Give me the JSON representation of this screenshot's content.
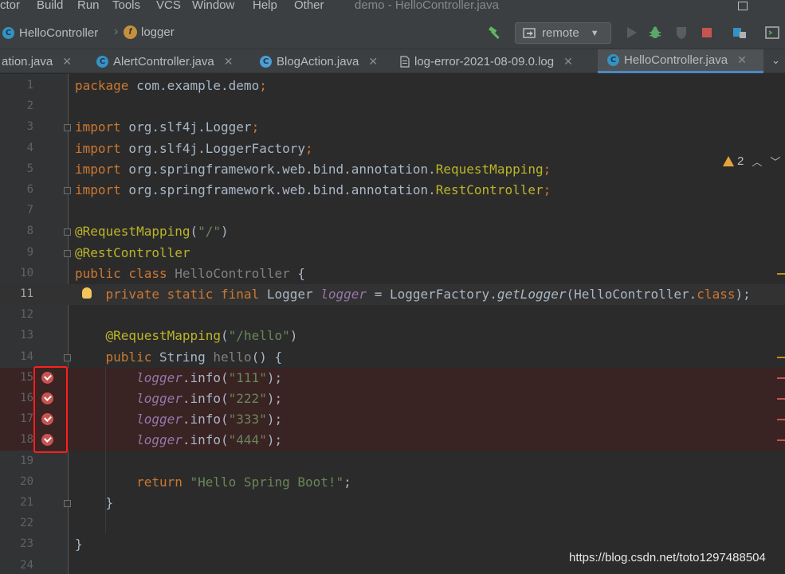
{
  "menu": {
    "items": [
      "ctor",
      "Build",
      "Run",
      "Tools",
      "VCS",
      "Window",
      "Help",
      "Other"
    ]
  },
  "window": {
    "title": "demo - HelloController.java"
  },
  "breadcrumb": {
    "class_name": "HelloController",
    "field_name": "logger"
  },
  "toolbar": {
    "run_config": "remote"
  },
  "tabs": [
    {
      "label": "ation.java"
    },
    {
      "label": "AlertController.java"
    },
    {
      "label": "BlogAction.java"
    },
    {
      "label": "log-error-2021-08-09.0.log"
    },
    {
      "label": "HelloController.java"
    }
  ],
  "editor": {
    "warnings_count": "2",
    "lines": [
      {
        "n": "1",
        "parts": [
          {
            "t": "package",
            "c": "kw"
          },
          {
            "t": " com.example.demo"
          },
          {
            "t": ";",
            "c": "kw"
          }
        ]
      },
      {
        "n": "2",
        "parts": []
      },
      {
        "n": "3",
        "parts": [
          {
            "t": "import",
            "c": "kw"
          },
          {
            "t": " org.slf4j.Logger"
          },
          {
            "t": ";",
            "c": "kw"
          }
        ]
      },
      {
        "n": "4",
        "parts": [
          {
            "t": "import",
            "c": "kw"
          },
          {
            "t": " org.slf4j.LoggerFactory"
          },
          {
            "t": ";",
            "c": "kw"
          }
        ]
      },
      {
        "n": "5",
        "parts": [
          {
            "t": "import",
            "c": "kw"
          },
          {
            "t": " org.springframework.web.bind.annotation."
          },
          {
            "t": "RequestMapping",
            "c": "an"
          },
          {
            "t": ";",
            "c": "kw"
          }
        ]
      },
      {
        "n": "6",
        "parts": [
          {
            "t": "import",
            "c": "kw"
          },
          {
            "t": " org.springframework.web.bind.annotation."
          },
          {
            "t": "RestController",
            "c": "an"
          },
          {
            "t": ";",
            "c": "kw"
          }
        ]
      },
      {
        "n": "7",
        "parts": []
      },
      {
        "n": "8",
        "parts": [
          {
            "t": "@RequestMapping",
            "c": "an"
          },
          {
            "t": "("
          },
          {
            "t": "\"/\"",
            "c": "str"
          },
          {
            "t": ")"
          }
        ]
      },
      {
        "n": "9",
        "parts": [
          {
            "t": "@RestController",
            "c": "an"
          }
        ]
      },
      {
        "n": "10",
        "parts": [
          {
            "t": "public class ",
            "c": "kw"
          },
          {
            "t": "HelloController",
            "c": "gray"
          },
          {
            "t": " {"
          }
        ]
      },
      {
        "n": "11",
        "parts": [
          {
            "t": "    "
          },
          {
            "t": "private static final ",
            "c": "kw"
          },
          {
            "t": "Logger "
          },
          {
            "t": "logger",
            "c": "it"
          },
          {
            "t": " = LoggerFactory."
          },
          {
            "t": "getLogger",
            "c": "mi"
          },
          {
            "t": "(HelloController."
          },
          {
            "t": "class",
            "c": "kw"
          },
          {
            "t": ");"
          }
        ]
      },
      {
        "n": "12",
        "parts": []
      },
      {
        "n": "13",
        "parts": [
          {
            "t": "    "
          },
          {
            "t": "@RequestMapping",
            "c": "an"
          },
          {
            "t": "("
          },
          {
            "t": "\"/hello\"",
            "c": "str"
          },
          {
            "t": ")"
          }
        ]
      },
      {
        "n": "14",
        "parts": [
          {
            "t": "    "
          },
          {
            "t": "public ",
            "c": "kw"
          },
          {
            "t": "String "
          },
          {
            "t": "hello",
            "c": "gray"
          },
          {
            "t": "() {"
          }
        ]
      },
      {
        "n": "15",
        "parts": [
          {
            "t": "        "
          },
          {
            "t": "logger",
            "c": "it"
          },
          {
            "t": ".info("
          },
          {
            "t": "\"111\"",
            "c": "str"
          },
          {
            "t": ");"
          }
        ]
      },
      {
        "n": "16",
        "parts": [
          {
            "t": "        "
          },
          {
            "t": "logger",
            "c": "it"
          },
          {
            "t": ".info("
          },
          {
            "t": "\"222\"",
            "c": "str"
          },
          {
            "t": ");"
          }
        ]
      },
      {
        "n": "17",
        "parts": [
          {
            "t": "        "
          },
          {
            "t": "logger",
            "c": "it"
          },
          {
            "t": ".info("
          },
          {
            "t": "\"333\"",
            "c": "str"
          },
          {
            "t": ");"
          }
        ]
      },
      {
        "n": "18",
        "parts": [
          {
            "t": "        "
          },
          {
            "t": "logger",
            "c": "it"
          },
          {
            "t": ".info("
          },
          {
            "t": "\"444\"",
            "c": "str"
          },
          {
            "t": ");"
          }
        ]
      },
      {
        "n": "19",
        "parts": []
      },
      {
        "n": "20",
        "parts": [
          {
            "t": "        "
          },
          {
            "t": "return ",
            "c": "kw"
          },
          {
            "t": "\"Hello Spring Boot!\"",
            "c": "str"
          },
          {
            "t": ";"
          }
        ]
      },
      {
        "n": "21",
        "parts": [
          {
            "t": "    }"
          }
        ]
      },
      {
        "n": "22",
        "parts": []
      },
      {
        "n": "23",
        "parts": [
          {
            "t": "}"
          }
        ]
      },
      {
        "n": "24",
        "parts": []
      }
    ],
    "current_line": "11",
    "breakpoint_lines": [
      "15",
      "16",
      "17",
      "18"
    ]
  },
  "watermark": "https://blog.csdn.net/toto1297488504",
  "colors": {
    "breakpoint": "#c75450",
    "highlight_box": "#ff1e1e",
    "active_tab_underline": "#4a88c7"
  }
}
